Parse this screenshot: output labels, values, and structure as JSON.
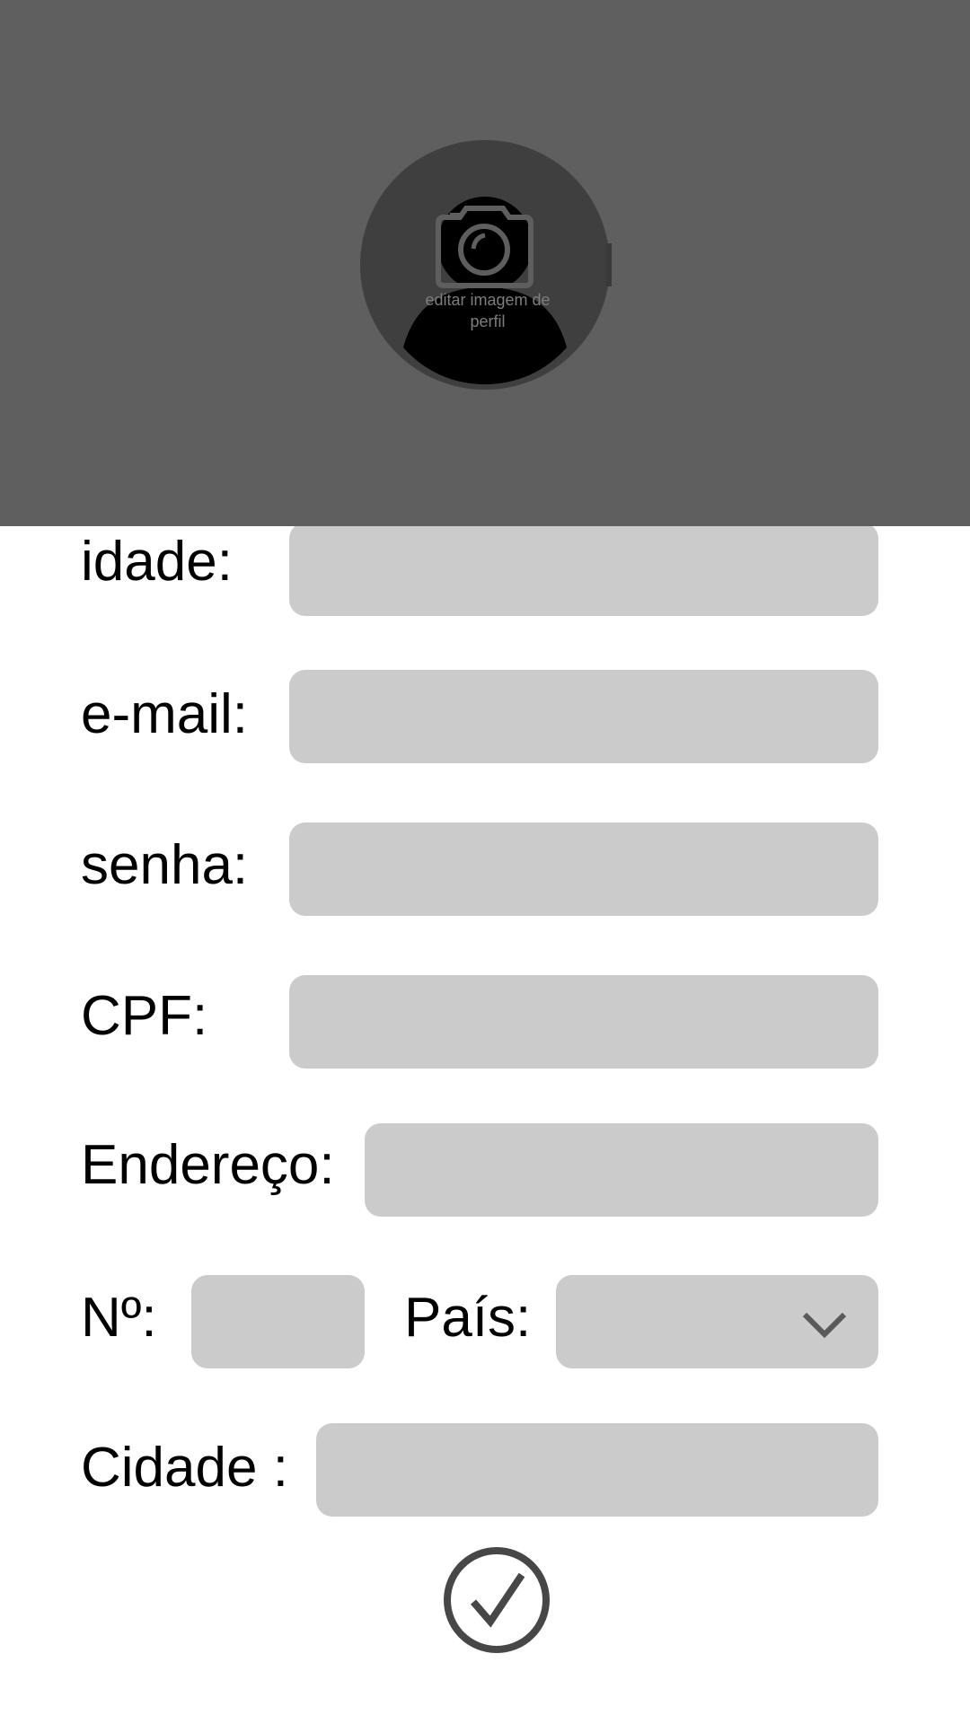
{
  "profile": {
    "edit_image_label": "editar imagem de perfil",
    "avatar_icon": "user-silhouette-icon",
    "camera_icon": "camera-icon"
  },
  "form": {
    "age": {
      "label": "idade:",
      "value": "",
      "placeholder": ""
    },
    "email": {
      "label": "e-mail:",
      "value": "",
      "placeholder": ""
    },
    "password": {
      "label": "senha:",
      "value": "",
      "placeholder": ""
    },
    "cpf": {
      "label": "CPF:",
      "value": "",
      "placeholder": ""
    },
    "address": {
      "label": "Endereço:",
      "value": "",
      "placeholder": ""
    },
    "number": {
      "label": "Nº:",
      "value": "",
      "placeholder": ""
    },
    "country": {
      "label": "País:",
      "selected": "",
      "icon": "chevron-down-icon"
    },
    "city": {
      "label": "Cidade :",
      "value": "",
      "placeholder": ""
    }
  },
  "actions": {
    "confirm_icon": "check-circle-icon"
  },
  "colors": {
    "header_bg": "#5f5f5f",
    "avatar_bg": "#3f3f3f",
    "field_bg": "#cbcbcb",
    "icon_gray": "#474747"
  }
}
